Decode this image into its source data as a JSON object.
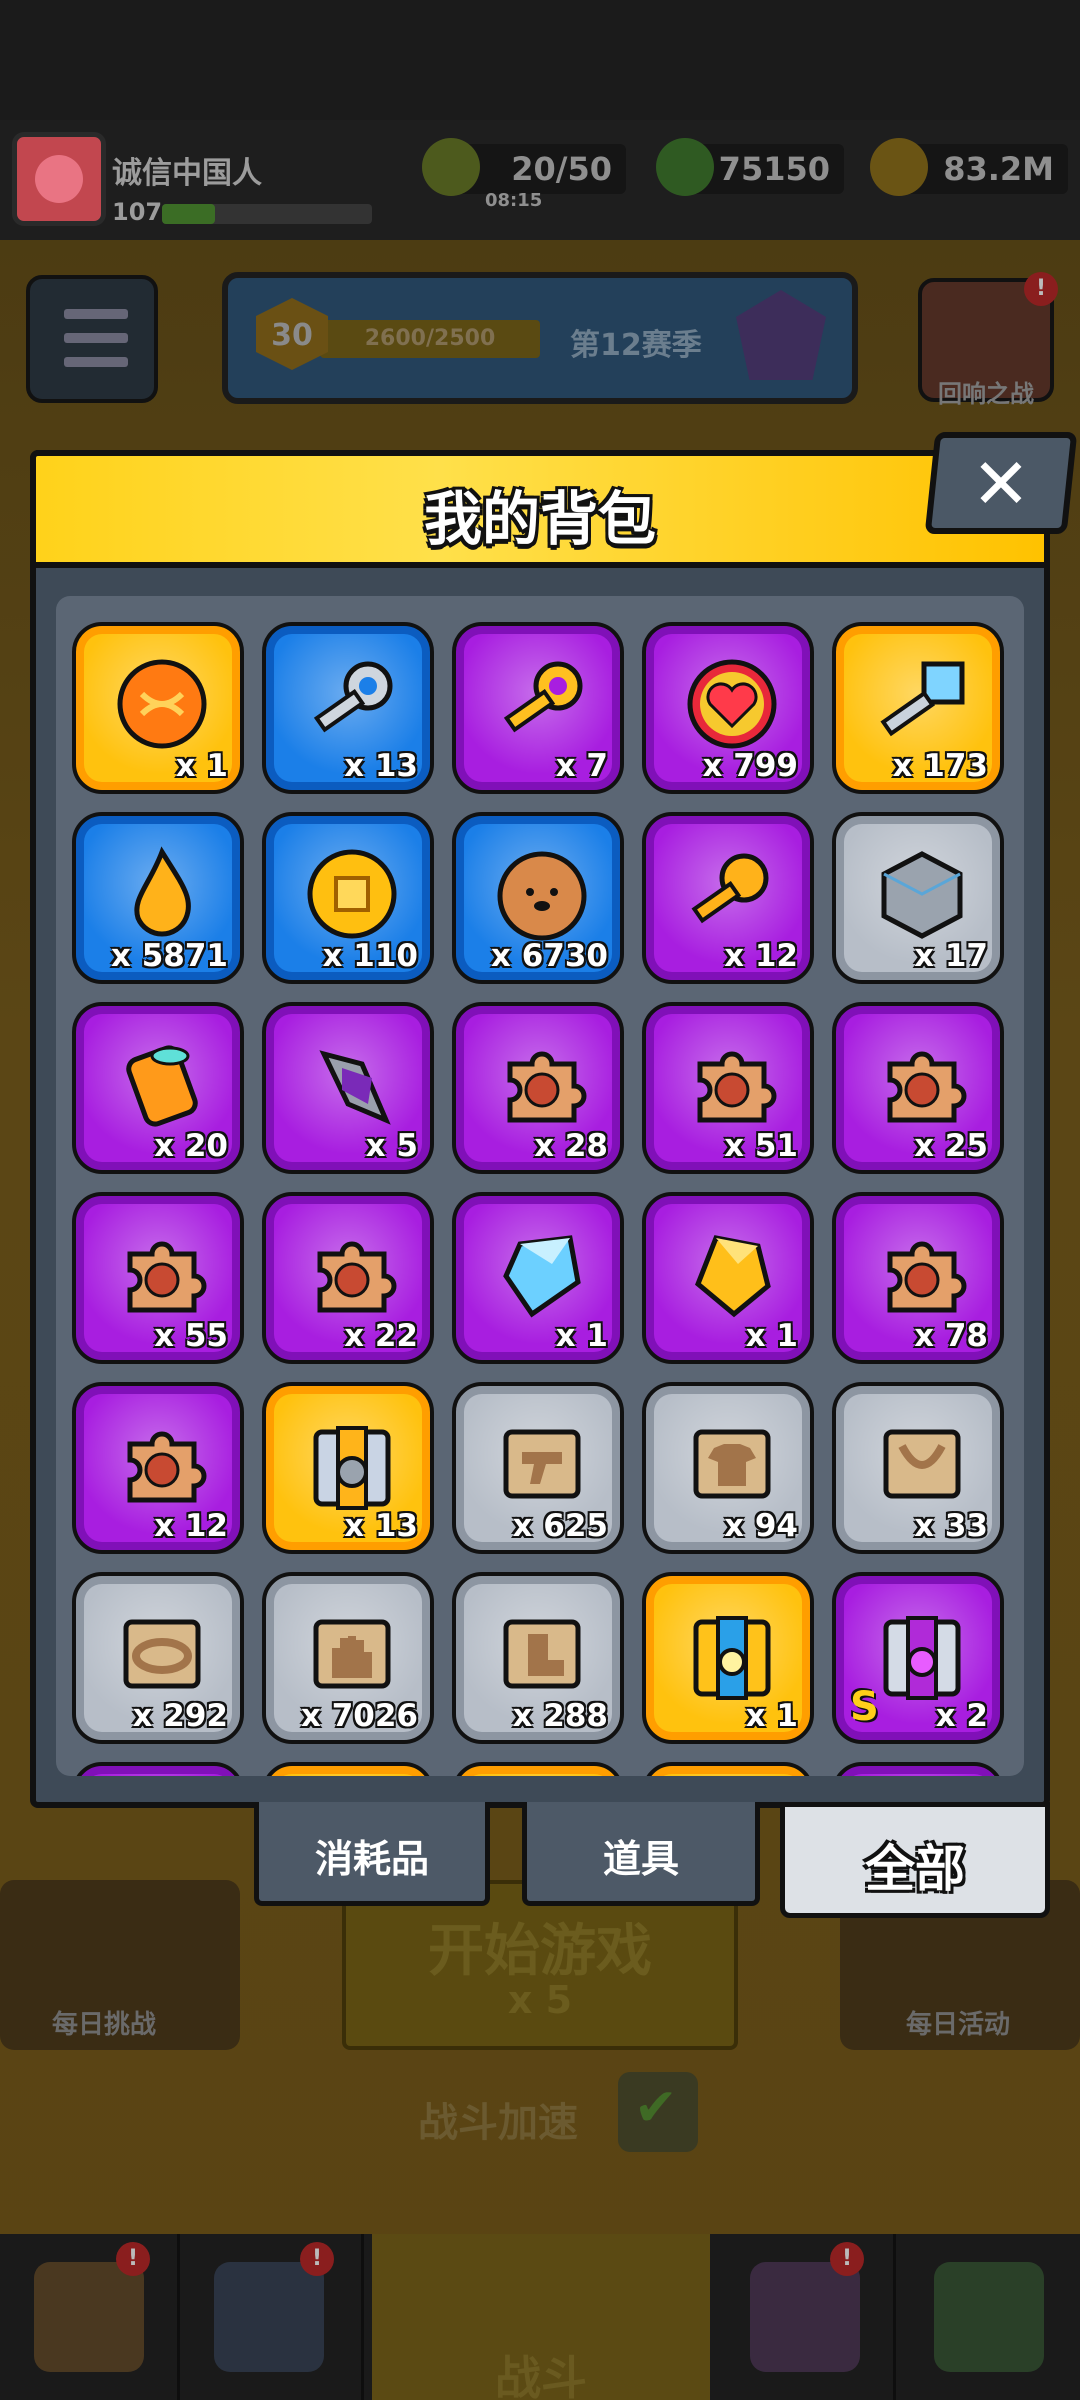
{
  "player": {
    "name": "诚信中国人",
    "level": "107",
    "xp_fraction": 0.25
  },
  "resources": {
    "energy": "20/50",
    "energy_timer": "08:15",
    "gems": "75150",
    "coins": "83.2M"
  },
  "season": {
    "level": "30",
    "progress": "2600/2500",
    "name": "第12赛季"
  },
  "echo_battle_label": "回响之战",
  "modal": {
    "title": "我的背包"
  },
  "items": [
    {
      "qty": "x 1",
      "rarity": "orange",
      "icon": "orange-swirl-orb-icon"
    },
    {
      "qty": "x 13",
      "rarity": "blue",
      "icon": "silver-key-icon"
    },
    {
      "qty": "x 7",
      "rarity": "purple",
      "icon": "gold-key-icon"
    },
    {
      "qty": "x 799",
      "rarity": "purple",
      "icon": "heart-token-icon"
    },
    {
      "qty": "x 173",
      "rarity": "orange",
      "icon": "crystal-key-icon"
    },
    {
      "qty": "x 5871",
      "rarity": "blue",
      "icon": "flame-drop-icon"
    },
    {
      "qty": "x 110",
      "rarity": "blue",
      "icon": "gold-coin-icon"
    },
    {
      "qty": "x 6730",
      "rarity": "blue",
      "icon": "dog-cookie-icon"
    },
    {
      "qty": "x 12",
      "rarity": "purple",
      "icon": "paw-key-icon"
    },
    {
      "qty": "x 17",
      "rarity": "gray",
      "icon": "steel-cube-icon"
    },
    {
      "qty": "x 20",
      "rarity": "purple",
      "icon": "power-cell-icon"
    },
    {
      "qty": "x 5",
      "rarity": "purple",
      "icon": "dark-crystal-icon"
    },
    {
      "qty": "x 28",
      "rarity": "purple",
      "icon": "hero-puzzle-piece-icon"
    },
    {
      "qty": "x 51",
      "rarity": "purple",
      "icon": "hero-puzzle-piece-icon"
    },
    {
      "qty": "x 25",
      "rarity": "purple",
      "icon": "hero-puzzle-piece-icon"
    },
    {
      "qty": "x 55",
      "rarity": "purple",
      "icon": "hero-puzzle-piece-icon"
    },
    {
      "qty": "x 22",
      "rarity": "purple",
      "icon": "hero-puzzle-piece-icon"
    },
    {
      "qty": "x 1",
      "rarity": "purple",
      "icon": "blue-gem-icon"
    },
    {
      "qty": "x 1",
      "rarity": "purple",
      "icon": "gold-gem-icon"
    },
    {
      "qty": "x 78",
      "rarity": "purple",
      "icon": "hero-puzzle-piece-icon"
    },
    {
      "qty": "x 12",
      "rarity": "purple",
      "icon": "hero-puzzle-piece-icon"
    },
    {
      "qty": "x 13",
      "rarity": "orange",
      "icon": "treasure-chest-icon"
    },
    {
      "qty": "x 625",
      "rarity": "gray",
      "icon": "gun-scroll-icon"
    },
    {
      "qty": "x 94",
      "rarity": "gray",
      "icon": "shirt-scroll-icon"
    },
    {
      "qty": "x 33",
      "rarity": "gray",
      "icon": "necklace-scroll-icon"
    },
    {
      "qty": "x 292",
      "rarity": "gray",
      "icon": "belt-scroll-icon"
    },
    {
      "qty": "x 7026",
      "rarity": "gray",
      "icon": "glove-scroll-icon"
    },
    {
      "qty": "x 288",
      "rarity": "gray",
      "icon": "boots-scroll-icon"
    },
    {
      "qty": "x 1",
      "rarity": "orange",
      "icon": "gold-chest-icon"
    },
    {
      "qty": "x 2",
      "rarity": "purple",
      "icon": "s-chest-icon",
      "badge": "S"
    }
  ],
  "tabs": [
    {
      "label": "消耗品",
      "active": false
    },
    {
      "label": "道具",
      "active": false
    },
    {
      "label": "全部",
      "active": true
    }
  ],
  "bottom": {
    "daily_challenge": "每日挑战",
    "daily_event": "每日活动",
    "start_game": "开始游戏",
    "start_cost": "x 5",
    "battle_speed": "战斗加速",
    "battle_tab": "战斗"
  },
  "colors": {
    "header_yellow": "#ffd21a",
    "orange_rarity": "#ffc20e",
    "blue_rarity": "#1b7fe8",
    "purple_rarity": "#a81ee0",
    "gray_rarity": "#b7bec8",
    "panel": "#3e4a57"
  }
}
